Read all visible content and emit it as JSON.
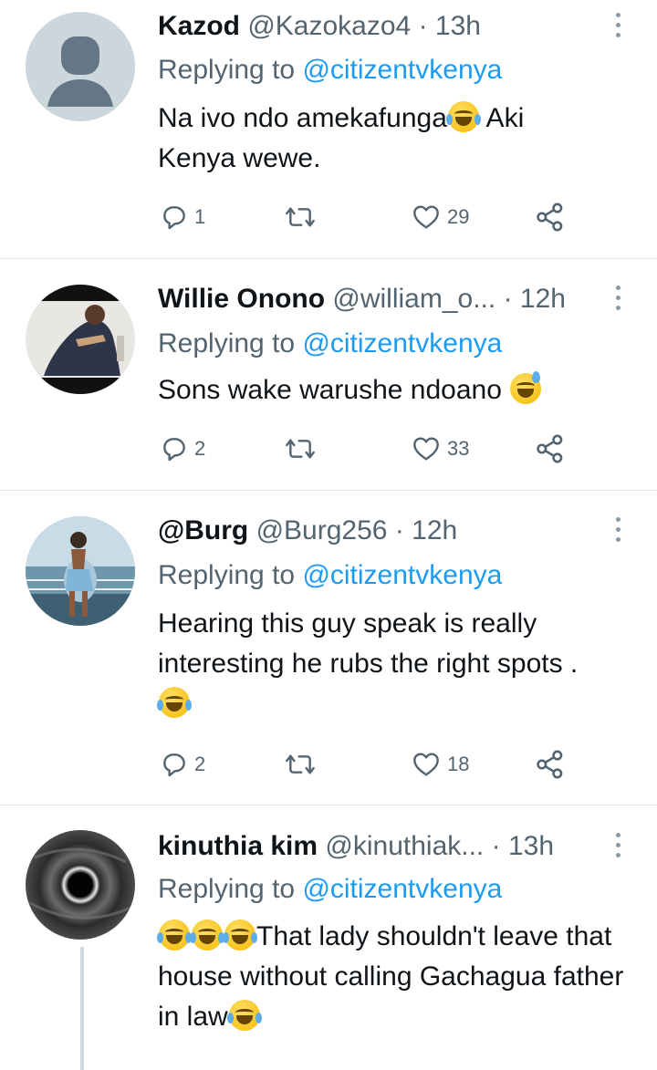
{
  "tweets": [
    {
      "name": "Kazod",
      "handle": "@Kazokazo4",
      "dot": "·",
      "time": "13h",
      "replying_prefix": "Replying to ",
      "replying_to": "@citizentvkenya",
      "body_parts": [
        "Na ivo ndo amekafunga",
        "[joy]",
        " Aki Kenya wewe."
      ],
      "replies": "1",
      "retweets": "",
      "likes": "29"
    },
    {
      "name": "Willie Onono",
      "handle": "@william_o...",
      "dot": "·",
      "time": "12h",
      "replying_prefix": "Replying to ",
      "replying_to": "@citizentvkenya",
      "body_parts": [
        "Sons wake warushe ndoano ",
        "[sweat_smile]"
      ],
      "replies": "2",
      "retweets": "",
      "likes": "33"
    },
    {
      "name": "@Burg",
      "handle": "@Burg256",
      "dot": "·",
      "time": "12h",
      "replying_prefix": "Replying to ",
      "replying_to": "@citizentvkenya",
      "body_parts": [
        "Hearing this guy speak is really interesting he rubs the right spots . ",
        "[joy]"
      ],
      "replies": "2",
      "retweets": "",
      "likes": "18"
    },
    {
      "name": "kinuthia kim",
      "handle": "@kinuthiak...",
      "dot": "·",
      "time": "13h",
      "replying_prefix": "Replying to ",
      "replying_to": "@citizentvkenya",
      "body_parts": [
        "[joy]",
        "[joy]",
        "[joy]",
        "That lady shouldn't leave that house without calling Gachagua father in law",
        "[joy]"
      ],
      "replies": "",
      "retweets": "",
      "likes": ""
    }
  ],
  "icons": {
    "reply": "reply-icon",
    "retweet": "retweet-icon",
    "like": "heart-icon",
    "share": "share-icon",
    "more": "more-icon"
  },
  "colors": {
    "link": "#1d9bf0",
    "secondary_text": "#536471",
    "divider": "#dfe3e6"
  }
}
